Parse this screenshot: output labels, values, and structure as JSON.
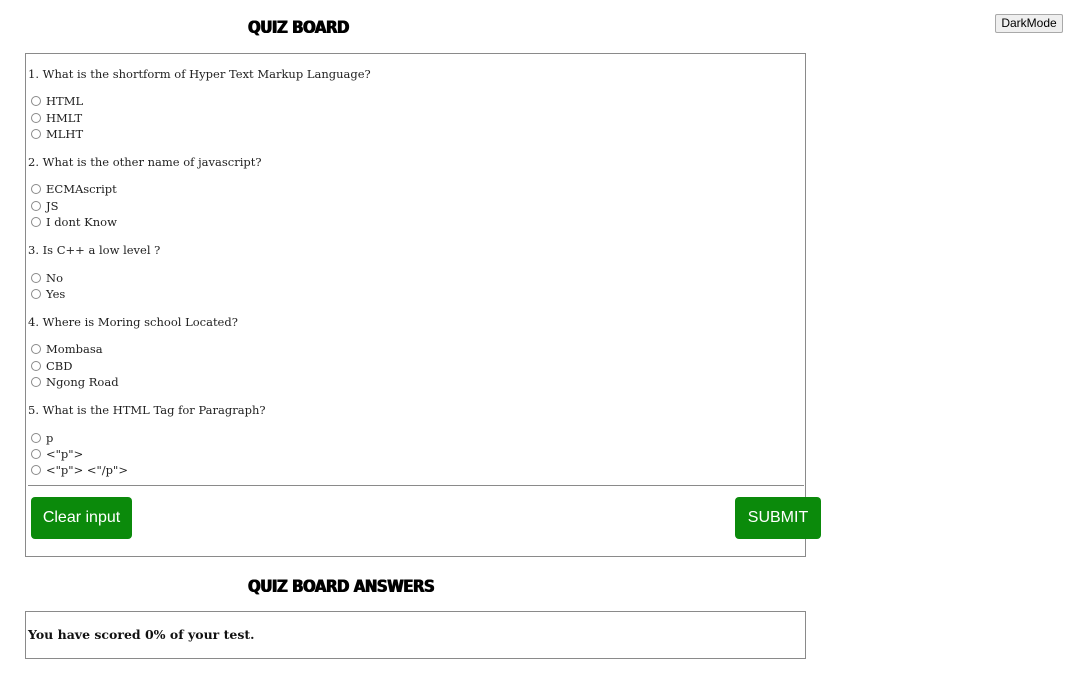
{
  "header": {
    "title": "QUIZ BOARD",
    "darkmode_label": "DarkMode"
  },
  "quiz": {
    "questions": [
      {
        "text": "1. What is the shortform of Hyper Text Markup Language?",
        "options": [
          "HTML",
          "HMLT",
          "MLHT"
        ]
      },
      {
        "text": "2. What is the other name of javascript?",
        "options": [
          "ECMAscript",
          "JS",
          "I dont Know"
        ]
      },
      {
        "text": "3. Is C++ a low level ?",
        "options": [
          "No",
          "Yes"
        ]
      },
      {
        "text": "4. Where is Moring school Located?",
        "options": [
          "Mombasa",
          "CBD",
          "Ngong Road"
        ]
      },
      {
        "text": "5. What is the HTML Tag for Paragraph?",
        "options": [
          "p",
          "<\"p\">",
          "<\"p\"> <\"/p\">"
        ]
      }
    ],
    "clear_label": "Clear input",
    "submit_label": "SUBMIT"
  },
  "answers": {
    "title": "QUIZ BOARD ANSWERS",
    "result_text": "You have scored 0% of your test."
  },
  "colors": {
    "button_green": "#0b8a0b",
    "border_gray": "#8a8a8a"
  }
}
